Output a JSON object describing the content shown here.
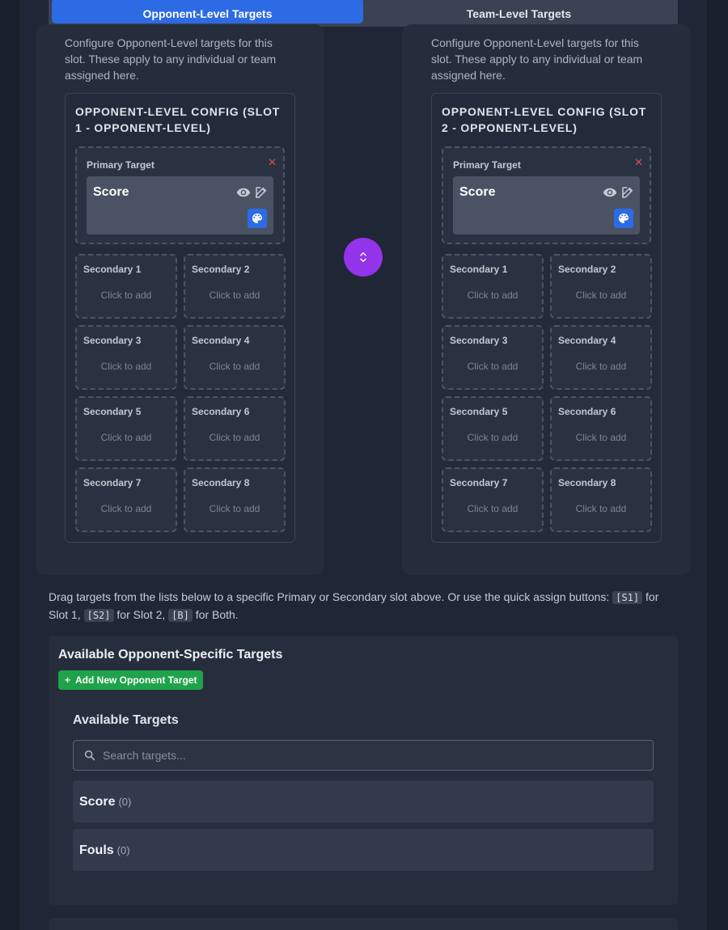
{
  "tabs": [
    {
      "label": "Opponent-Level Targets",
      "active": true
    },
    {
      "label": "Team-Level Targets",
      "active": false
    }
  ],
  "slots": [
    {
      "description": "Configure Opponent-Level targets for this slot. These apply to any individual or team assigned here.",
      "config_title": "OPPONENT-LEVEL CONFIG (SLOT 1 - OPPONENT-LEVEL)",
      "primary_label": "Primary Target",
      "primary_value": "Score",
      "secondary": [
        {
          "label": "Secondary 1",
          "hint": "Click to add"
        },
        {
          "label": "Secondary 2",
          "hint": "Click to add"
        },
        {
          "label": "Secondary 3",
          "hint": "Click to add"
        },
        {
          "label": "Secondary 4",
          "hint": "Click to add"
        },
        {
          "label": "Secondary 5",
          "hint": "Click to add"
        },
        {
          "label": "Secondary 6",
          "hint": "Click to add"
        },
        {
          "label": "Secondary 7",
          "hint": "Click to add"
        },
        {
          "label": "Secondary 8",
          "hint": "Click to add"
        }
      ]
    },
    {
      "description": "Configure Opponent-Level targets for this slot. These apply to any individual or team assigned here.",
      "config_title": "OPPONENT-LEVEL CONFIG (SLOT 2 - OPPONENT-LEVEL)",
      "primary_label": "Primary Target",
      "primary_value": "Score",
      "secondary": [
        {
          "label": "Secondary 1",
          "hint": "Click to add"
        },
        {
          "label": "Secondary 2",
          "hint": "Click to add"
        },
        {
          "label": "Secondary 3",
          "hint": "Click to add"
        },
        {
          "label": "Secondary 4",
          "hint": "Click to add"
        },
        {
          "label": "Secondary 5",
          "hint": "Click to add"
        },
        {
          "label": "Secondary 6",
          "hint": "Click to add"
        },
        {
          "label": "Secondary 7",
          "hint": "Click to add"
        },
        {
          "label": "Secondary 8",
          "hint": "Click to add"
        }
      ]
    }
  ],
  "hint": {
    "part1": "Drag targets from the lists below to a specific Primary or Secondary slot above. Or use the quick assign buttons: ",
    "code1": "[S1]",
    "part2": " for Slot 1, ",
    "code2": "[S2]",
    "part3": " for Slot 2, ",
    "code3": "[B]",
    "part4": " for Both."
  },
  "available": {
    "title": "Available Opponent-Specific Targets",
    "add_button": "Add New Opponent Target",
    "subtitle": "Available Targets",
    "search_placeholder": "Search targets...",
    "targets": [
      {
        "name": "Score",
        "count": "(0)"
      },
      {
        "name": "Fouls",
        "count": "(0)"
      }
    ]
  },
  "icons": {
    "visibility": "eye-icon",
    "edit": "edit-icon",
    "palette": "palette-icon",
    "remove": "close-icon",
    "swap": "swap-vertical-icon",
    "search": "search-icon",
    "add": "plus-icon"
  },
  "colors": {
    "accent_blue": "#2d6be4",
    "swap_purple": "#9333ea",
    "add_green": "#1fa34a",
    "remove_red": "#e04b4b"
  }
}
